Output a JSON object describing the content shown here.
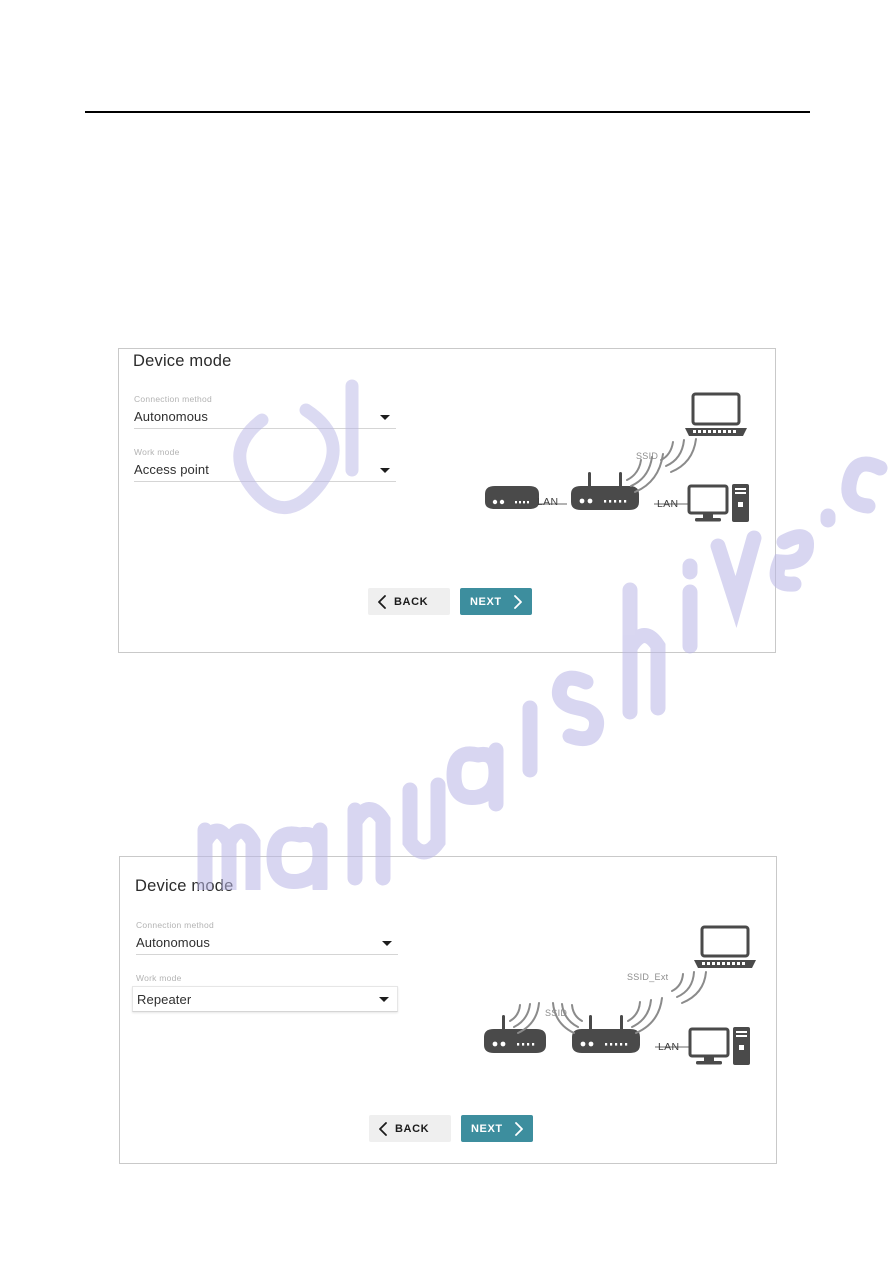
{
  "page": {
    "background": "#ffffff",
    "rule_color": "#000000"
  },
  "theme": {
    "accent": "#3d8e9e",
    "button_back_bg": "#efefef",
    "card_border": "#c9c9c9",
    "label_color": "#b3b3b3",
    "value_color": "#2f2f2f",
    "diagram_ink": "#4a4a4a",
    "diagram_label": "#8d8d8d",
    "watermark_color": "#b9b6e6"
  },
  "watermark": {
    "text": "manualshive.com"
  },
  "cards": [
    {
      "id": "access-point",
      "title": "Device mode",
      "fields": [
        {
          "name": "connection-method",
          "label": "Connection method",
          "value": "Autonomous",
          "raised": false
        },
        {
          "name": "work-mode",
          "label": "Work mode",
          "value": "Access point",
          "raised": false
        }
      ],
      "buttons": {
        "back": "BACK",
        "next": "NEXT"
      },
      "diagram": {
        "type": "access-point",
        "nodes": [
          {
            "name": "modem",
            "icon": "modem-icon"
          },
          {
            "name": "router",
            "icon": "router-icon"
          },
          {
            "name": "laptop",
            "icon": "laptop-icon"
          },
          {
            "name": "desktop",
            "icon": "desktop-pc-icon"
          }
        ],
        "labels": {
          "lan_left": "LAN",
          "lan_right": "LAN",
          "ssid": "SSID"
        }
      }
    },
    {
      "id": "repeater",
      "title": "Device mode",
      "fields": [
        {
          "name": "connection-method",
          "label": "Connection method",
          "value": "Autonomous",
          "raised": false
        },
        {
          "name": "work-mode",
          "label": "Work mode",
          "value": "Repeater",
          "raised": true
        }
      ],
      "buttons": {
        "back": "BACK",
        "next": "NEXT"
      },
      "diagram": {
        "type": "repeater",
        "nodes": [
          {
            "name": "source-router",
            "icon": "router-icon"
          },
          {
            "name": "repeater-router",
            "icon": "router-icon"
          },
          {
            "name": "laptop",
            "icon": "laptop-icon"
          },
          {
            "name": "desktop",
            "icon": "desktop-pc-icon"
          }
        ],
        "labels": {
          "ssid": "SSID",
          "ssid_ext": "SSID_Ext",
          "lan": "LAN"
        }
      }
    }
  ]
}
